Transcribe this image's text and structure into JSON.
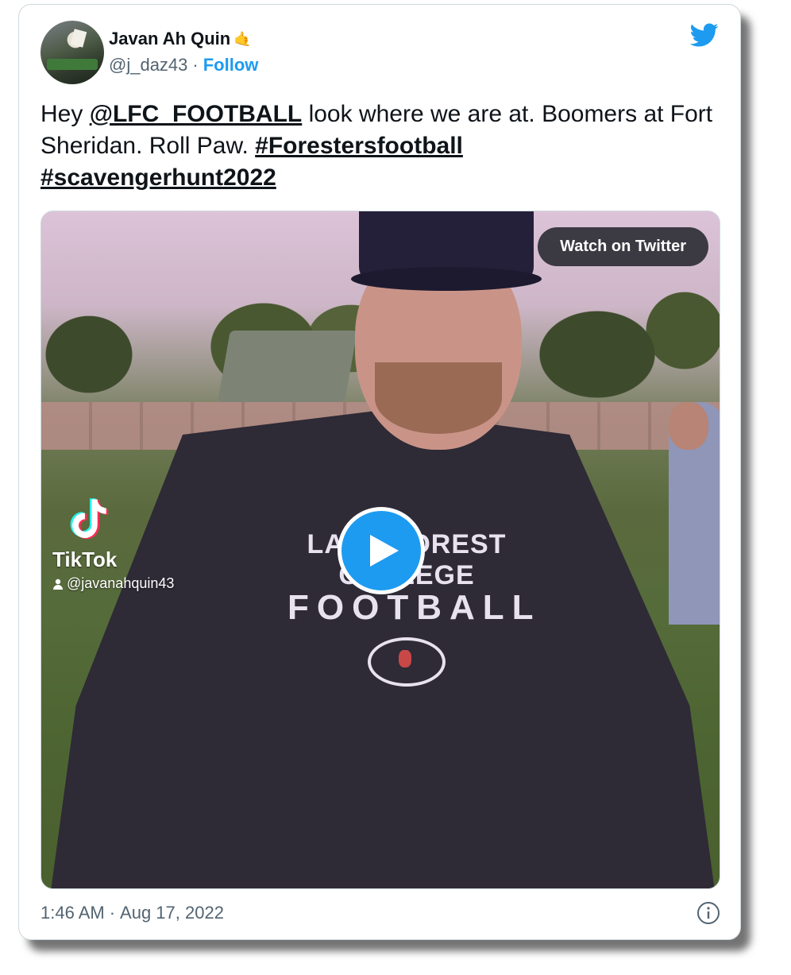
{
  "author": {
    "display_name": "Javan Ah Quin",
    "emoji": "🤙",
    "handle": "@j_daz43",
    "separator": "·",
    "follow_label": "Follow"
  },
  "tweet": {
    "parts": [
      {
        "text": "Hey ",
        "type": "plain"
      },
      {
        "text": "@LFC_FOOTBALL",
        "type": "mention"
      },
      {
        "text": " look where we are at. Boomers at Fort Sheridan. Roll Paw. ",
        "type": "plain"
      },
      {
        "text": "#Forestersfootball",
        "type": "hashtag"
      },
      {
        "text": " ",
        "type": "plain"
      },
      {
        "text": "#scavengerhunt2022",
        "type": "hashtag"
      }
    ]
  },
  "media": {
    "watch_label": "Watch on Twitter",
    "tiktok_label": "TikTok",
    "tiktok_user": "@javanahquin43",
    "shirt_line1": "LAKE FOREST COLLEGE",
    "shirt_line2": "FOOTBALL"
  },
  "footer": {
    "time": "1:46 AM",
    "separator": "·",
    "date": "Aug 17, 2022"
  },
  "colors": {
    "accent": "#1d9bf0",
    "text": "#0f1419",
    "muted": "#536471"
  },
  "icons": [
    "twitter-bird-icon",
    "play-icon",
    "tiktok-icon",
    "user-icon",
    "info-icon"
  ]
}
